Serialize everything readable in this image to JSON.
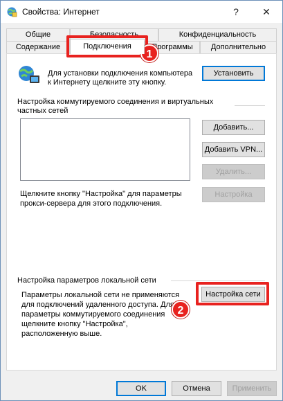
{
  "window": {
    "title": "Свойства: Интернет"
  },
  "titlebar_buttons": {
    "help": "?",
    "close": "✕"
  },
  "tabs_row1": [
    "Общие",
    "Безопасность",
    "Конфиденциальность"
  ],
  "tabs_row2": [
    "Содержание",
    "Подключения",
    "Программы",
    "Дополнительно"
  ],
  "setup": {
    "text_line1": "Для установки подключения компьютера",
    "text_line2": "к Интернету щелкните эту кнопку.",
    "button": "Установить"
  },
  "dialup": {
    "heading_line1": "Настройка коммутируемого соединения и виртуальных",
    "heading_line2": "частных сетей",
    "add_button": "Добавить...",
    "add_vpn_button": "Добавить VPN...",
    "remove_button": "Удалить...",
    "settings_button": "Настройка",
    "hint_line1": "Щелкните кнопку \"Настройка\" для параметры",
    "hint_line2": "прокси-сервера для этого подключения."
  },
  "lan": {
    "heading": "Настройка параметров локальной сети",
    "text_line1": "Параметры локальной сети не применяются",
    "text_line2": "для подключений удаленного доступа. Для",
    "text_line3": "параметры коммутируемого соединения",
    "text_line4": "щелкните кнопку \"Настройка\",",
    "text_line5": "расположенную выше.",
    "button": "Настройка сети"
  },
  "footer": {
    "ok": "OK",
    "cancel": "Отмена",
    "apply": "Применить"
  },
  "annotations": {
    "badge1": "1",
    "badge2": "2",
    "color": "#e8221f"
  }
}
